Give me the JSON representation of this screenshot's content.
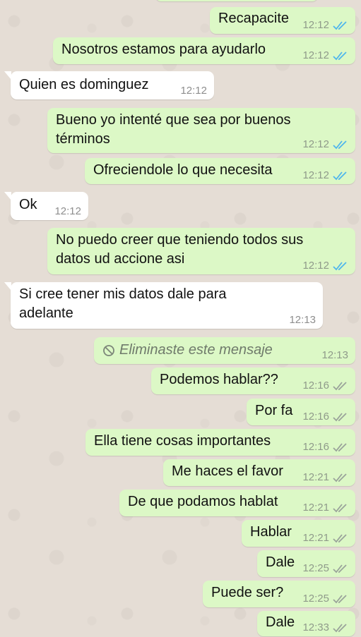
{
  "colors": {
    "outgoing_bubble": "#dcf8c6",
    "incoming_bubble": "#ffffff",
    "read_ticks": "#4fb6ec",
    "delivered_ticks": "#9aa39a",
    "wallpaper": "#e5ddd5"
  },
  "messages": [
    {
      "id": "m1",
      "dir": "out",
      "text": "Recapacite",
      "time": "12:12",
      "status": "read"
    },
    {
      "id": "m2",
      "dir": "out",
      "text": "Nosotros estamos para ayudarlo",
      "time": "12:12",
      "status": "read"
    },
    {
      "id": "m3",
      "dir": "in",
      "text": "Quien es dominguez",
      "time": "12:12"
    },
    {
      "id": "m4",
      "dir": "out",
      "text": "Bueno yo intenté que sea por buenos\ntérminos",
      "time": "12:12",
      "status": "read"
    },
    {
      "id": "m5",
      "dir": "out",
      "text": "Ofreciendole lo que necesita",
      "time": "12:12",
      "status": "read"
    },
    {
      "id": "m6",
      "dir": "in",
      "text": "Ok",
      "time": "12:12"
    },
    {
      "id": "m7",
      "dir": "out",
      "text": "No puedo creer que teniendo todos sus\ndatos ud accione asi",
      "time": "12:12",
      "status": "read"
    },
    {
      "id": "m8",
      "dir": "in",
      "text": "Si cree tener mis datos dale para\nadelante",
      "time": "12:13"
    },
    {
      "id": "m9",
      "dir": "out",
      "text": "Eliminaste este mensaje",
      "time": "12:13",
      "deleted": true,
      "icon": "blocked-icon"
    },
    {
      "id": "m10",
      "dir": "out",
      "text": "Podemos hablar??",
      "time": "12:16",
      "status": "delivered"
    },
    {
      "id": "m11",
      "dir": "out",
      "text": "Por fa",
      "time": "12:16",
      "status": "delivered"
    },
    {
      "id": "m12",
      "dir": "out",
      "text": "Ella tiene cosas importantes",
      "time": "12:16",
      "status": "delivered"
    },
    {
      "id": "m13",
      "dir": "out",
      "text": "Me haces el favor",
      "time": "12:21",
      "status": "delivered"
    },
    {
      "id": "m14",
      "dir": "out",
      "text": "De que podamos hablat",
      "time": "12:21",
      "status": "delivered"
    },
    {
      "id": "m15",
      "dir": "out",
      "text": "Hablar",
      "time": "12:21",
      "status": "delivered"
    },
    {
      "id": "m16",
      "dir": "out",
      "text": "Dale",
      "time": "12:25",
      "status": "delivered"
    },
    {
      "id": "m17",
      "dir": "out",
      "text": "Puede ser?",
      "time": "12:25",
      "status": "delivered"
    },
    {
      "id": "m18",
      "dir": "out",
      "text": "Dale",
      "time": "12:33",
      "status": "delivered"
    }
  ]
}
